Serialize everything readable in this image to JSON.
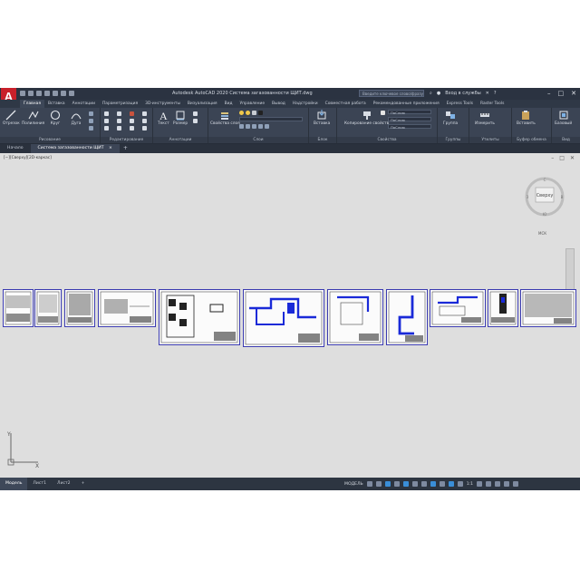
{
  "app": {
    "title": "Autodesk AutoCAD 2020   Система загазованности ЩИТ.dwg",
    "search_placeholder": "Введите ключевое слово/фразу",
    "sign_in": "Вход в службы",
    "logo_letter": "A",
    "brand_color": "#c8202a",
    "ribbon_color": "#3b4454"
  },
  "ribbon_tabs": [
    "Главная",
    "Вставка",
    "Аннотации",
    "Параметризация",
    "3D-инструменты",
    "Визуализация",
    "Вид",
    "Управление",
    "Вывод",
    "Надстройки",
    "Совместная работа",
    "Рекомендованные приложения",
    "Express Tools",
    "Raster Tools"
  ],
  "ribbon": {
    "draw": {
      "line": "Отрезок",
      "polyline": "Полилиния",
      "circle": "Круг",
      "arc": "Дуга",
      "group": "Рисование"
    },
    "modify": {
      "group": "Редактирование"
    },
    "annotation": {
      "text": "Текст",
      "dimension": "Размер",
      "group": "Аннотации"
    },
    "layers": {
      "properties": "Свойства слоя",
      "group": "Слои"
    },
    "block": {
      "insert": "Вставка",
      "group": "Блок"
    },
    "properties": {
      "match": "Копирование свойств",
      "by_layer_1": "ПоСлою",
      "by_layer_2": "ПоСлою",
      "by_layer_3": "ПоСлою",
      "group": "Свойства"
    },
    "groups": {
      "label": "Группа",
      "group": "Группы"
    },
    "utilities": {
      "measure": "Измерить",
      "group": "Утилиты"
    },
    "clipboard": {
      "paste": "Вставить",
      "group": "Буфер обмена"
    },
    "view": {
      "base": "Базовый",
      "group": "Вид"
    }
  },
  "file_tabs": {
    "start": "Начало",
    "current": "Система загазованности ЩИТ",
    "close": "×",
    "plus": "+"
  },
  "viewport": {
    "label": "[−][Сверху][2D-каркас]",
    "viewcube_face": "Сверху",
    "compass_n": "С",
    "compass_s": "Ю",
    "compass_w": "З",
    "compass_e": "В",
    "wcs": "МСК"
  },
  "ucs": {
    "x": "X",
    "y": "Y"
  },
  "layout_tabs": [
    "Модель",
    "Лист1",
    "Лист2"
  ],
  "layout_plus": "+",
  "status": {
    "model": "МОДЕЛЬ",
    "scale": "1:1"
  },
  "icons": [
    "app-menu-icon",
    "new-icon",
    "open-icon",
    "save-icon",
    "undo-icon",
    "redo-icon",
    "help-icon",
    "minimize-icon",
    "maximize-icon",
    "close-icon"
  ]
}
